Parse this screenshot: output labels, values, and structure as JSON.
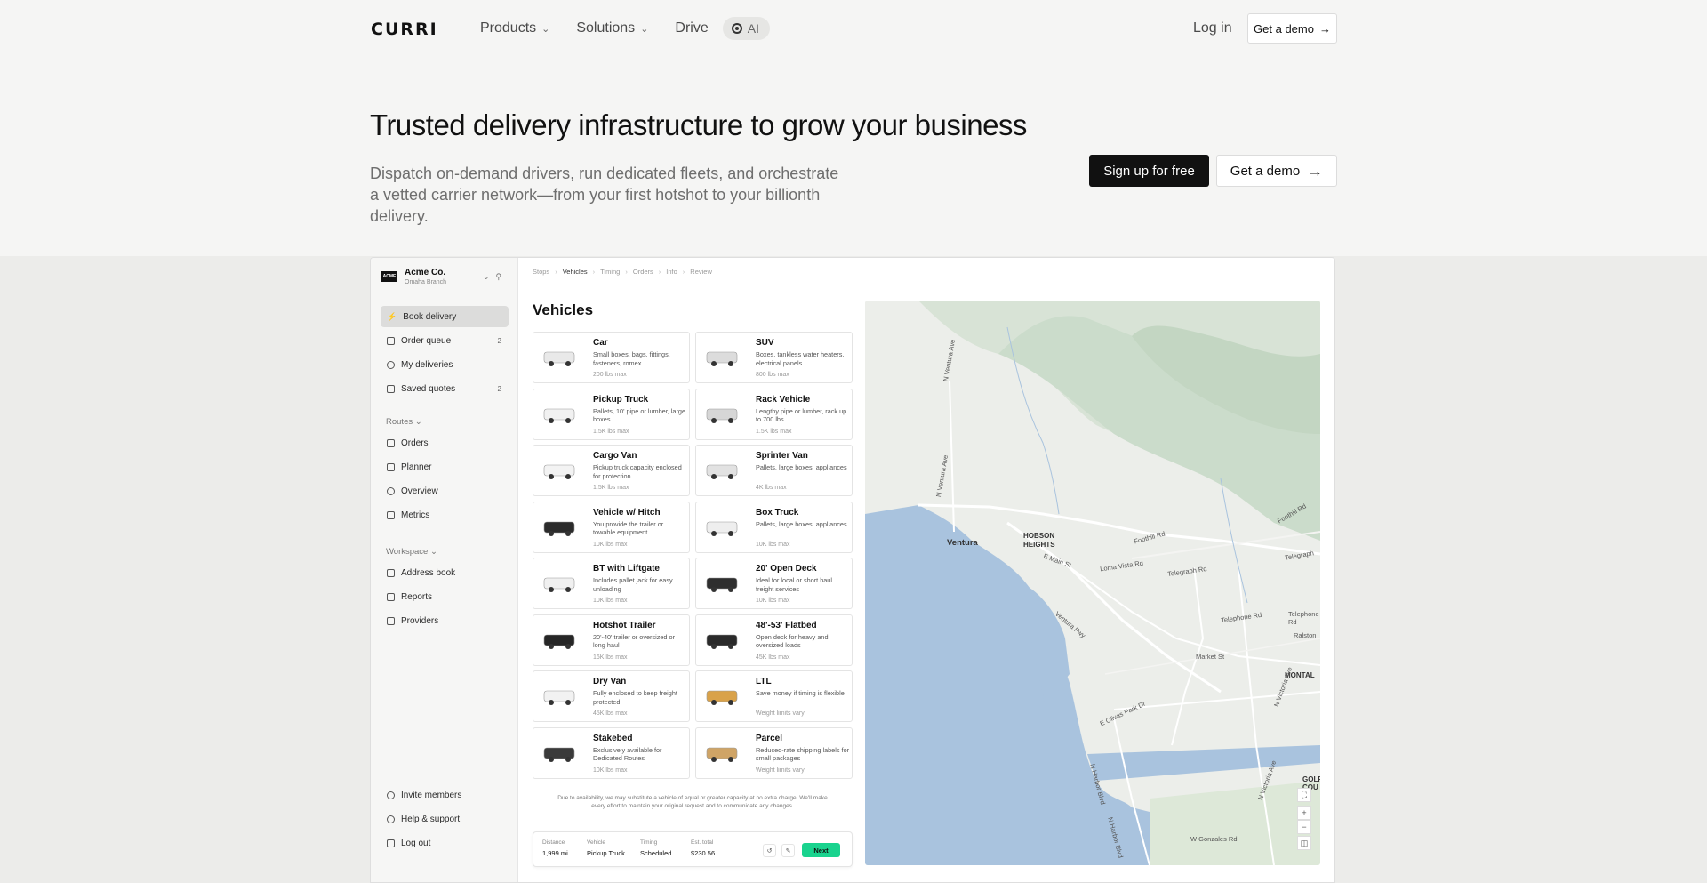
{
  "nav": {
    "logo": "CURRI",
    "links": [
      "Products",
      "Solutions",
      "Drive"
    ],
    "ai_label": "AI",
    "login": "Log in",
    "demo": "Get a demo"
  },
  "hero": {
    "title": "Trusted delivery infrastructure to grow your business",
    "subtitle": "Dispatch on-demand drivers, run dedicated fleets, and orchestrate a vetted carrier network—from your first hotshot to your billionth delivery.",
    "signup": "Sign up for free",
    "demo": "Get a demo"
  },
  "app": {
    "org": {
      "logo": "ACME",
      "name": "Acme Co.",
      "branch": "Omaha Branch"
    },
    "sidebar": {
      "primary": [
        {
          "label": "Book delivery",
          "badge": ""
        },
        {
          "label": "Order queue",
          "badge": "2"
        },
        {
          "label": "My deliveries",
          "badge": ""
        },
        {
          "label": "Saved quotes",
          "badge": "2"
        }
      ],
      "routes_title": "Routes",
      "routes": [
        "Orders",
        "Planner",
        "Overview",
        "Metrics"
      ],
      "workspace_title": "Workspace",
      "workspace": [
        "Address book",
        "Reports",
        "Providers"
      ],
      "bottom": [
        "Invite members",
        "Help & support",
        "Log out"
      ]
    },
    "breadcrumbs": [
      "Stops",
      "Vehicles",
      "Timing",
      "Orders",
      "Info",
      "Review"
    ],
    "vehicles_title": "Vehicles",
    "vehicles": [
      {
        "name": "Car",
        "desc": "Small boxes, bags, fittings, fasteners, romex",
        "max": "200 lbs max"
      },
      {
        "name": "SUV",
        "desc": "Boxes, tankless water heaters, electrical panels",
        "max": "800 lbs max"
      },
      {
        "name": "Pickup Truck",
        "desc": "Pallets, 10' pipe or lumber, large boxes",
        "max": "1.5K lbs max"
      },
      {
        "name": "Rack Vehicle",
        "desc": "Lengthy pipe or lumber, rack up to 700 lbs.",
        "max": "1.5K lbs max"
      },
      {
        "name": "Cargo Van",
        "desc": "Pickup truck capacity enclosed for protection",
        "max": "1.5K lbs max"
      },
      {
        "name": "Sprinter Van",
        "desc": "Pallets, large boxes, appliances",
        "max": "4K lbs max"
      },
      {
        "name": "Vehicle w/ Hitch",
        "desc": "You provide the trailer or towable equipment",
        "max": "10K lbs max"
      },
      {
        "name": "Box Truck",
        "desc": "Pallets, large boxes, appliances",
        "max": "10K lbs max"
      },
      {
        "name": "BT with Liftgate",
        "desc": "Includes pallet jack for easy unloading",
        "max": "10K lbs max"
      },
      {
        "name": "20' Open Deck",
        "desc": "Ideal for local or short haul freight services",
        "max": "10K lbs max"
      },
      {
        "name": "Hotshot Trailer",
        "desc": "20'-40' trailer or oversized or long haul",
        "max": "16K lbs max"
      },
      {
        "name": "48'-53' Flatbed",
        "desc": "Open deck for heavy and oversized loads",
        "max": "45K lbs max"
      },
      {
        "name": "Dry Van",
        "desc": "Fully enclosed to keep freight protected",
        "max": "45K lbs max"
      },
      {
        "name": "LTL",
        "desc": "Save money if timing is flexible",
        "max": "Weight limits vary"
      },
      {
        "name": "Stakebed",
        "desc": "Exclusively available for Dedicated Routes",
        "max": "10K lbs max"
      },
      {
        "name": "Parcel",
        "desc": "Reduced-rate shipping labels for small packages",
        "max": "Weight limits vary"
      }
    ],
    "disclaimer": "Due to availability, we may substitute a vehicle of equal or greater capacity at no extra charge. We'll make every effort to maintain your original request and to communicate any changes.",
    "summary": [
      {
        "label": "Distance",
        "value": "1,999 mi"
      },
      {
        "label": "Vehicle",
        "value": "Pickup Truck"
      },
      {
        "label": "Timing",
        "value": "Scheduled"
      },
      {
        "label": "Est. total",
        "value": "$230.56"
      }
    ],
    "next": "Next",
    "map_labels": {
      "ventura": "Ventura",
      "hobson": "HOBSON",
      "heights": "HEIGHTS",
      "montal": "MONTAL",
      "golf": "GOLF COU",
      "n_ventura_ave": "N Ventura Ave",
      "foothill": "Foothill Rd",
      "foothill2": "Foothill Rd",
      "e_main": "E Main St",
      "loma_vista": "Loma Vista Rd",
      "telegraph": "Telegraph Rd",
      "telegraph2": "Telegraph",
      "telephone": "Telephone Rd",
      "ralston": "Ralston",
      "ventura_fwy": "Ventura Fwy",
      "market": "Market St",
      "olivas": "E Olivas Park Dr",
      "harbor": "N Harbor Blvd",
      "victoria": "N Victoria Ave",
      "gonzales": "W Gonzales Rd"
    }
  }
}
